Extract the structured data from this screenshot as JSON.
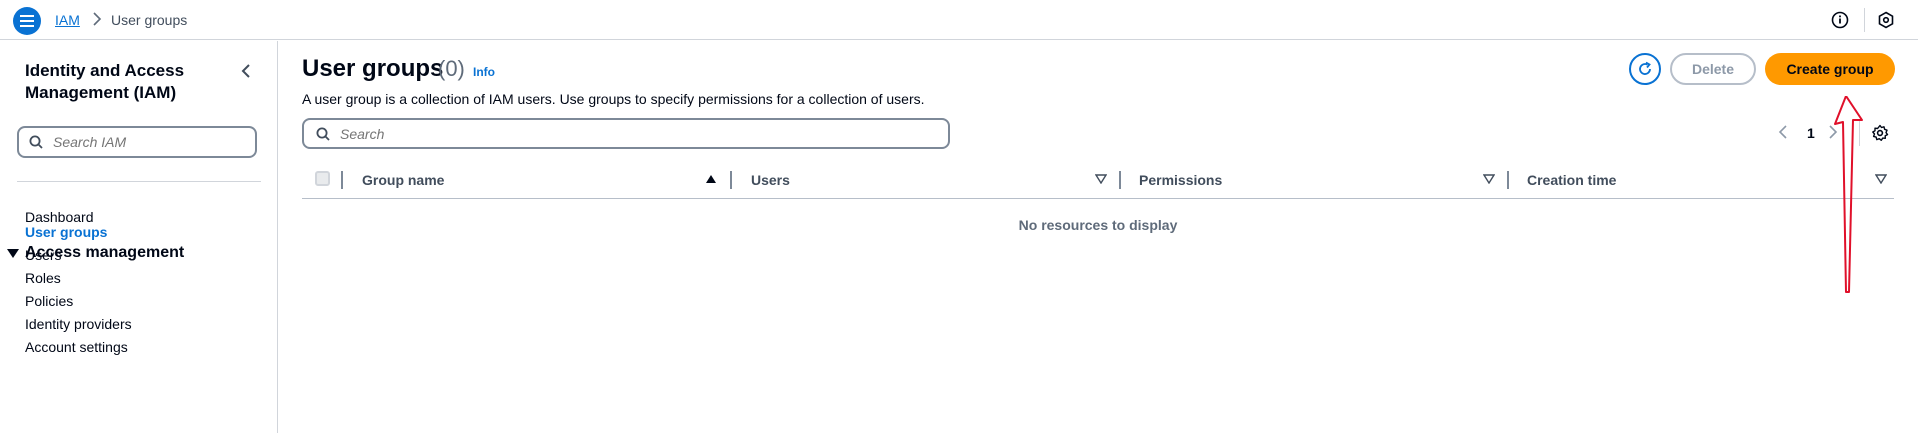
{
  "breadcrumb": {
    "root": "IAM",
    "current": "User groups"
  },
  "sidebar": {
    "title": "Identity and Access Management (IAM)",
    "search_placeholder": "Search IAM",
    "dashboard": "Dashboard",
    "section": "Access management",
    "items": [
      {
        "label": "User groups",
        "active": true
      },
      {
        "label": "Users",
        "active": false
      },
      {
        "label": "Roles",
        "active": false
      },
      {
        "label": "Policies",
        "active": false
      },
      {
        "label": "Identity providers",
        "active": false
      },
      {
        "label": "Account settings",
        "active": false
      }
    ]
  },
  "main": {
    "title": "User groups",
    "count": "(0)",
    "info": "Info",
    "description": "A user group is a collection of IAM users. Use groups to specify permissions for a collection of users.",
    "search_placeholder": "Search",
    "delete_label": "Delete",
    "create_label": "Create group",
    "page_number": "1",
    "columns": [
      "Group name",
      "Users",
      "Permissions",
      "Creation time"
    ],
    "empty_message": "No resources to display"
  },
  "colors": {
    "accent": "#0972d3",
    "primary_button": "#ff9900",
    "annotation": "#e0102a"
  },
  "icons": {
    "menu": "hamburger-menu-icon",
    "info": "info-circle-icon",
    "settings": "gear-icon",
    "refresh": "refresh-icon",
    "search": "search-icon",
    "collapse": "chevron-left-icon"
  }
}
